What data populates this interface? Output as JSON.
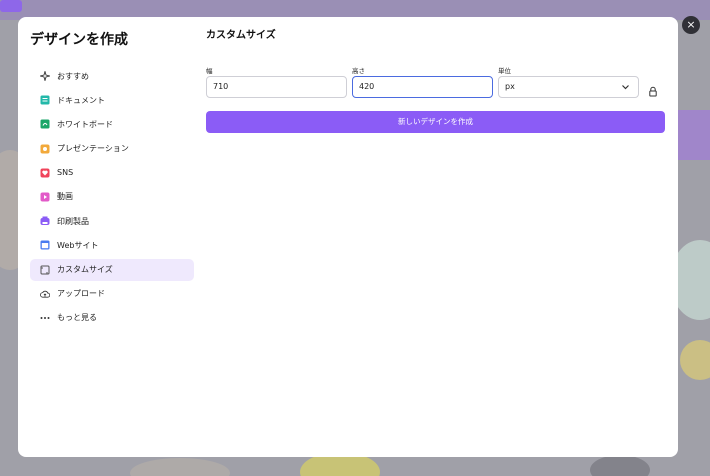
{
  "modal": {
    "title": "デザインを作成",
    "close_symbol": "×"
  },
  "sidebar": {
    "items": [
      {
        "label": "おすすめ",
        "icon": "sparkles-icon",
        "color": "#333333"
      },
      {
        "label": "ドキュメント",
        "icon": "document-icon",
        "color": "#23b8a9"
      },
      {
        "label": "ホワイトボード",
        "icon": "whiteboard-icon",
        "color": "#1aa668"
      },
      {
        "label": "プレゼンテーション",
        "icon": "presentation-icon",
        "color": "#f2a93b"
      },
      {
        "label": "SNS",
        "icon": "heart-icon",
        "color": "#f0445b"
      },
      {
        "label": "動画",
        "icon": "video-icon",
        "color": "#e25ac8"
      },
      {
        "label": "印刷製品",
        "icon": "print-icon",
        "color": "#8b5cf6"
      },
      {
        "label": "Webサイト",
        "icon": "website-icon",
        "color": "#4a7cf0"
      },
      {
        "label": "カスタムサイズ",
        "icon": "custom-size-icon",
        "color": "#555555"
      },
      {
        "label": "アップロード",
        "icon": "upload-cloud-icon",
        "color": "#333333"
      },
      {
        "label": "もっと見る",
        "icon": "more-dots-icon",
        "color": "#333333"
      }
    ],
    "active_index": 8
  },
  "main": {
    "section_title": "カスタムサイズ",
    "width_label": "幅",
    "width_value": "710",
    "height_label": "高さ",
    "height_value": "420",
    "unit_label": "単位",
    "unit_value": "px",
    "create_button": "新しいデザインを作成"
  },
  "colors": {
    "accent": "#8b5cf6",
    "active_bg": "#efe9fd",
    "focus": "#4b6be0"
  }
}
